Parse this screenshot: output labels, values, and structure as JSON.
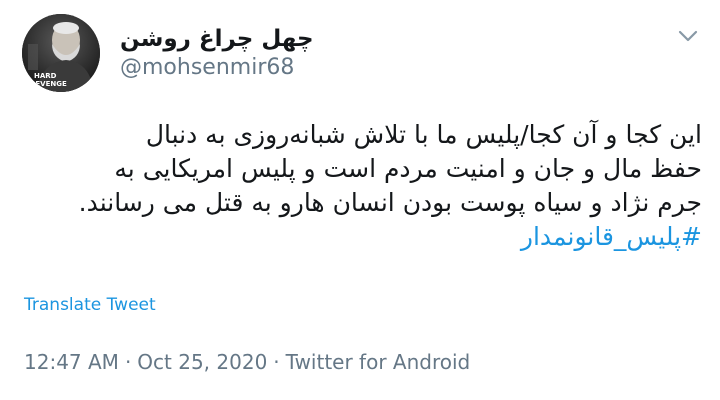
{
  "author": {
    "display_name": "چهل چراغ روشن",
    "handle": "@mohsenmir68",
    "avatar_icon": "profile-avatar-photo",
    "avatar_caption": "HARD REVENGE"
  },
  "menu": {
    "icon": "chevron-down-icon"
  },
  "tweet": {
    "lines": [
      "این کجا و آن کجا/پلیس ما با تلاش شبانه‌روزی به دنبال",
      "حفظ مال و جان و امنیت مردم است و پلیس امریکایی به",
      "جرم نژاد و سیاه پوست بودن انسان هارو به قتل می رسانند."
    ],
    "hashtag": "#پلیس_قانونمدار"
  },
  "translate_label": "Translate Tweet",
  "meta": {
    "time": "12:47 AM",
    "separator": "·",
    "date": "Oct 25, 2020",
    "source": "Twitter for Android"
  },
  "colors": {
    "link": "#1b95e0",
    "secondary_text": "#657786",
    "primary_text": "#14171a"
  }
}
